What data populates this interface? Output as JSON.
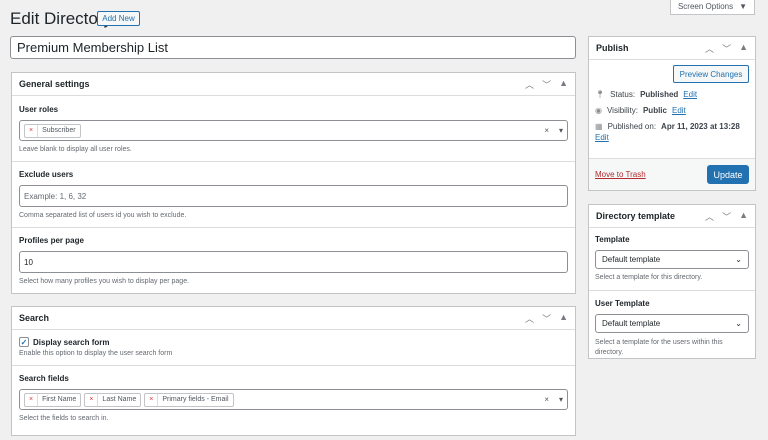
{
  "header": {
    "title": "Edit Directory",
    "add_new": "Add New",
    "screen_options": "Screen Options"
  },
  "title_input": {
    "value": "Premium Membership List"
  },
  "general": {
    "title": "General settings",
    "user_roles": {
      "label": "User roles",
      "tags": [
        "Subscriber"
      ],
      "help": "Leave blank to display all user roles."
    },
    "exclude_users": {
      "label": "Exclude users",
      "placeholder": "Example: 1, 6, 32",
      "help": "Comma separated list of users id you wish to exclude."
    },
    "profiles_per_page": {
      "label": "Profiles per page",
      "value": "10",
      "help": "Select how many profiles you wish to display per page."
    }
  },
  "search": {
    "title": "Search",
    "display_search_form": {
      "label": "Display search form",
      "checked": true,
      "help": "Enable this option to display the user search form"
    },
    "search_fields": {
      "label": "Search fields",
      "tags": [
        "First Name",
        "Last Name",
        "Primary fields - Email"
      ],
      "help": "Select the fields to search in."
    }
  },
  "publish": {
    "title": "Publish",
    "preview": "Preview Changes",
    "status_label": "Status:",
    "status": "Published",
    "visibility_label": "Visibility:",
    "visibility": "Public",
    "published_label": "Published on:",
    "published": "Apr 11, 2023 at 13:28",
    "edit": "Edit",
    "trash": "Move to Trash",
    "update": "Update"
  },
  "directory_template": {
    "title": "Directory template",
    "template_label": "Template",
    "template_value": "Default template",
    "template_help": "Select a template for this directory.",
    "user_template_label": "User Template",
    "user_template_value": "Default template",
    "user_template_help": "Select a template for the users within this directory."
  },
  "colors": {
    "accent": "#2271b1",
    "danger": "#b32d2e"
  }
}
